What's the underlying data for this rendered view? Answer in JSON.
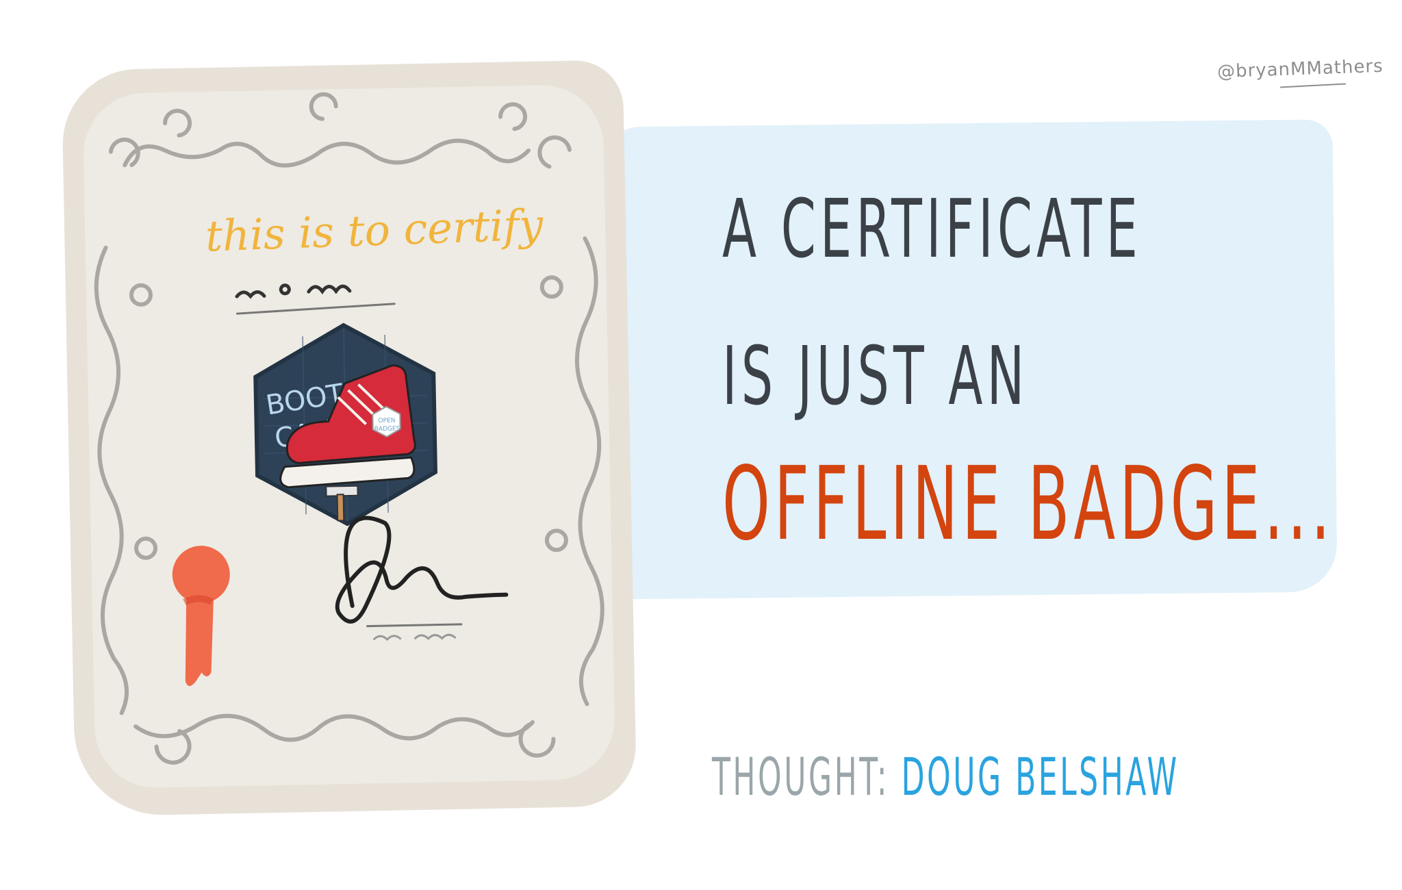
{
  "attribution": "@bryanMMathers",
  "certificate": {
    "heading": "this is to certify",
    "badge": {
      "line1": "BOOT",
      "line2": "CAMP",
      "sub1": "OPEN",
      "sub2": "BADGES"
    }
  },
  "headline": {
    "line1": "A CERTIFICATE",
    "line2": "IS JUST AN",
    "line3": "OFFLINE BADGE..."
  },
  "credit": {
    "label": "THOUGHT:",
    "name": "DOUG BELSHAW"
  },
  "colors": {
    "dark_text": "#3b4147",
    "accent_orange": "#d3440f",
    "accent_blue": "#2aa3df",
    "muted_grey": "#9aa6aa",
    "certificate_yellow": "#f1b43c",
    "panel_blue": "#e2f1fa"
  }
}
